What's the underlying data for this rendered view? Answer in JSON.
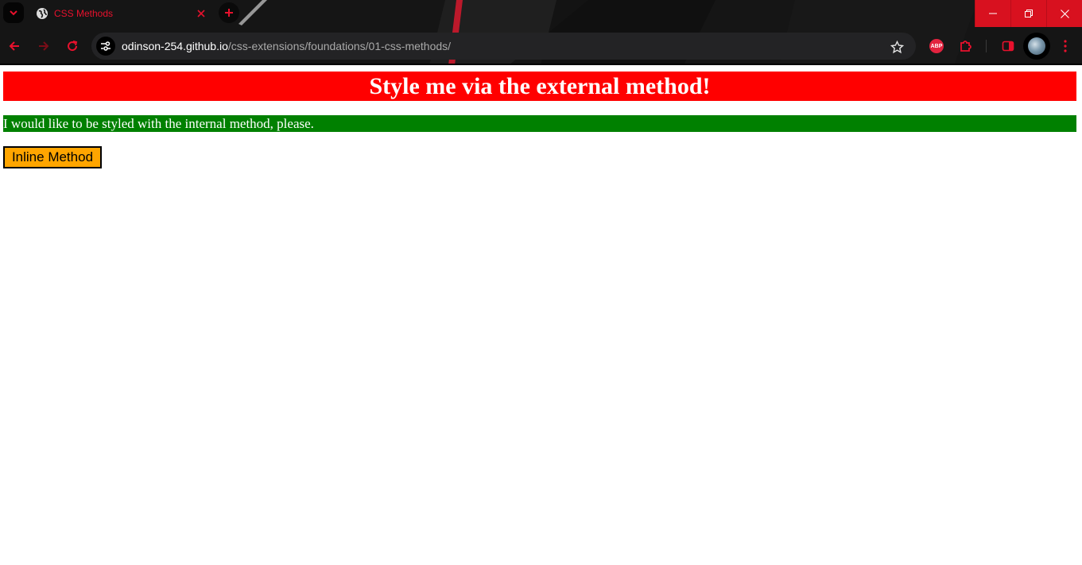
{
  "browser": {
    "tab": {
      "title": "CSS Methods"
    },
    "address_bar": {
      "host": "odinson-254.github.io",
      "path": "/css-extensions/foundations/01-css-methods/"
    },
    "extensions": {
      "abp_label": "ABP"
    },
    "accent_color": "#e8112d"
  },
  "page": {
    "heading": "Style me via the external method!",
    "internal_paragraph": "I would like to be styled with the internal method, please.",
    "inline_button": "Inline Method",
    "colors": {
      "heading_bg": "#ff0000",
      "paragraph_bg": "#008000",
      "button_bg": "#ffa500"
    }
  }
}
